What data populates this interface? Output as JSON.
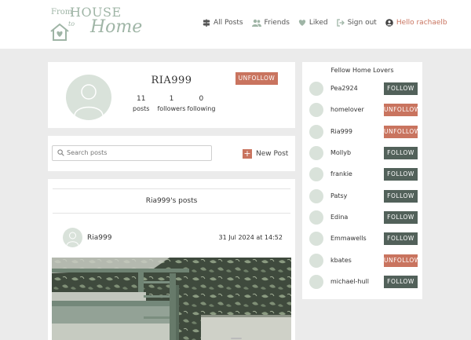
{
  "brand": {
    "from": "From",
    "house": "HOUSE",
    "to": "to",
    "home": "Home"
  },
  "nav": {
    "all_posts": "All Posts",
    "friends": "Friends",
    "liked": "Liked",
    "sign_out": "Sign out",
    "hello": "Hello rachaelb"
  },
  "profile": {
    "username": "RIA999",
    "posts_count": "11",
    "posts_label": "posts",
    "followers_count": "1",
    "followers_label": "followers",
    "following_count": "0",
    "following_label": "following",
    "action_label": "UNFOLLOW"
  },
  "search": {
    "placeholder": "Search posts"
  },
  "new_post_label": "New Post",
  "posts": {
    "title": "Ria999's posts",
    "items": [
      {
        "author": "Ria999",
        "date": "31 Jul 2024 at 14:52"
      }
    ]
  },
  "sidebar": {
    "title": "Fellow Home Lovers",
    "users": [
      {
        "name": "Pea2924",
        "action": "FOLLOW"
      },
      {
        "name": "homelover",
        "action": "UNFOLLOW"
      },
      {
        "name": "Ria999",
        "action": "UNFOLLOW"
      },
      {
        "name": "Mollyb",
        "action": "FOLLOW"
      },
      {
        "name": "frankie",
        "action": "FOLLOW"
      },
      {
        "name": "Patsy",
        "action": "FOLLOW"
      },
      {
        "name": "Edina",
        "action": "FOLLOW"
      },
      {
        "name": "Emmawells",
        "action": "FOLLOW"
      },
      {
        "name": "kbates",
        "action": "UNFOLLOW"
      },
      {
        "name": "michael-hull",
        "action": "FOLLOW"
      }
    ]
  },
  "colors": {
    "accent": "#c9745f",
    "follow": "#52615a",
    "avatar": "#d9e2da",
    "logo": "#9fb5a6",
    "background": "#ebebeb"
  }
}
